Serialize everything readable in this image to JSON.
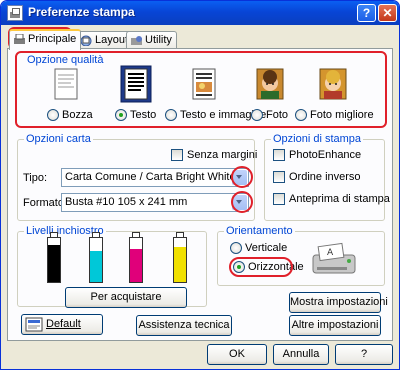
{
  "window": {
    "title": "Preferenze stampa"
  },
  "tabs": [
    {
      "label": "Principale",
      "icon": "printer-doc-icon"
    },
    {
      "label": "Layout",
      "icon": "layout-icon"
    },
    {
      "label": "Utility",
      "icon": "utility-icon"
    }
  ],
  "quality": {
    "title": "Opzione qualità",
    "options": [
      {
        "label": "Bozza",
        "icon": "draft-doc-icon",
        "selected": false
      },
      {
        "label": "Testo",
        "icon": "text-doc-icon",
        "selected": true
      },
      {
        "label": "Testo e immagine",
        "icon": "text-image-doc-icon",
        "selected": false
      },
      {
        "label": "Foto",
        "icon": "photo-icon",
        "selected": false
      },
      {
        "label": "Foto migliore",
        "icon": "best-photo-icon",
        "selected": false
      }
    ]
  },
  "paper": {
    "title": "Opzioni carta",
    "borderless": "Senza margini",
    "type_label": "Tipo:",
    "type_value": "Carta Comune / Carta Bright White",
    "format_label": "Formato:",
    "format_value": "Busta #10 105 x 241 mm"
  },
  "print_options": {
    "title": "Opzioni di stampa",
    "photoenhance": "PhotoEnhance",
    "reverse": "Ordine inverso",
    "preview": "Anteprima di stampa"
  },
  "ink": {
    "title": "Livelli inchiostro",
    "buy": "Per acquistare",
    "colors": [
      "#000000",
      "#00c8d8",
      "#e0007a",
      "#f0e000"
    ],
    "levels": [
      0.85,
      0.7,
      0.75,
      0.8
    ]
  },
  "orientation": {
    "title": "Orientamento",
    "portrait": "Verticale",
    "landscape": "Orizzontale",
    "selected": "landscape"
  },
  "buttons": {
    "show_settings": "Mostra impostazioni",
    "default": "Default",
    "support": "Assistenza tecnica",
    "other_settings": "Altre impostazioni",
    "ok": "OK",
    "cancel": "Annulla",
    "help": "?"
  },
  "titlebar": {
    "help": "?",
    "close": "✕"
  },
  "accent": {
    "annotation_red": "#e0202a",
    "title_blue": "#0046d5"
  }
}
